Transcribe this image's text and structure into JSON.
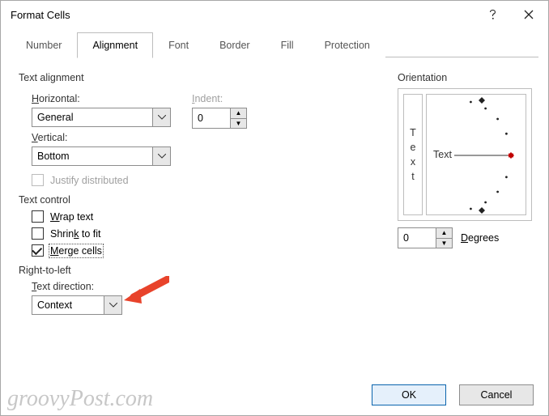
{
  "dialog": {
    "title": "Format Cells"
  },
  "tabs": {
    "number": "Number",
    "alignment": "Alignment",
    "font": "Font",
    "border": "Border",
    "fill": "Fill",
    "protection": "Protection"
  },
  "sections": {
    "text_alignment": "Text alignment",
    "text_control": "Text control",
    "right_to_left": "Right-to-left",
    "orientation": "Orientation"
  },
  "labels": {
    "horizontal": "orizontal:",
    "vertical": "ertical:",
    "indent": "ndent:",
    "justify": "Justify distributed",
    "wrap": "rap text",
    "shrink": "Shrin",
    "shrink_suffix": " to fit",
    "merge": "erge cells",
    "text_direction": "ext direction:",
    "degrees": "egrees",
    "text": "Text"
  },
  "values": {
    "horizontal": "General",
    "vertical": "Bottom",
    "indent": "0",
    "text_direction": "Context",
    "degrees": "0"
  },
  "checked": {
    "justify": false,
    "wrap": false,
    "shrink": false,
    "merge": true
  },
  "buttons": {
    "ok": "OK",
    "cancel": "Cancel"
  },
  "watermark": "groovyPost.com"
}
